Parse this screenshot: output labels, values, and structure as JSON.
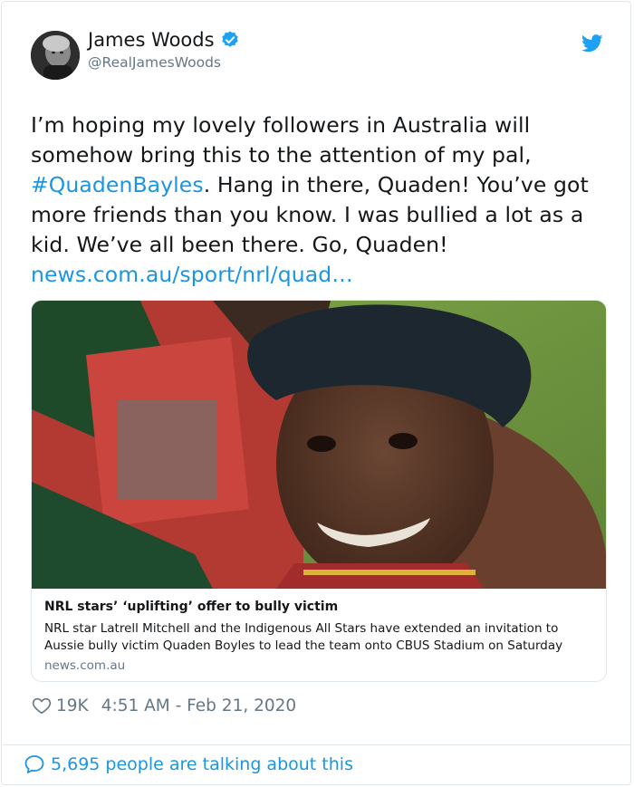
{
  "author": {
    "name": "James Woods",
    "handle": "@RealJamesWoods"
  },
  "tweet": {
    "text_part1": "I’m hoping my lovely followers in Australia will somehow bring this to the attention of my pal, ",
    "hashtag": "#QuadenBayles",
    "text_part2": ". Hang in there, Quaden! You’ve got more friends than you know. I was bullied a lot as a kid. We’ve all been there. Go, Quaden! ",
    "link": "news.com.au/sport/nrl/quad…"
  },
  "card": {
    "title": "NRL stars’ ‘uplifting’ offer to bully victim",
    "description": "NRL star Latrell Mitchell and the Indigenous All Stars have extended an invitation to Aussie bully victim Quaden Boyles to lead the team onto CBUS Stadium on Saturday",
    "domain": "news.com.au"
  },
  "meta": {
    "likes": "19K",
    "timestamp": "4:51 AM - Feb 21, 2020"
  },
  "footer": {
    "talking": "5,695 people are talking about this"
  },
  "icons": {
    "verified": "verified-badge-icon",
    "brand": "twitter-bird-icon",
    "like": "heart-icon",
    "reply": "speech-bubble-icon"
  },
  "colors": {
    "link": "#1b95e0",
    "text": "#14171a",
    "secondary": "#657786",
    "border": "#e1e8ed"
  }
}
